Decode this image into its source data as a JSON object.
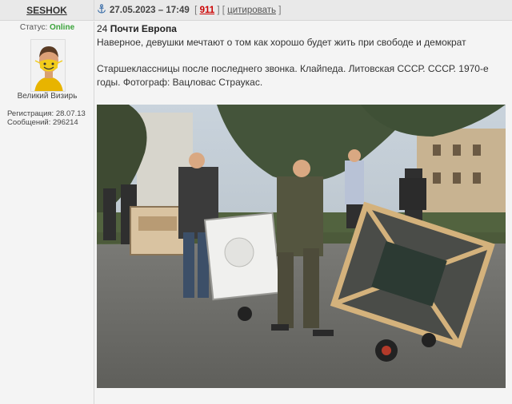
{
  "author": {
    "name": "SESHOK",
    "status_label": "Статус:",
    "status_value": "Online",
    "rank": "Великий Визирь",
    "registration_label": "Регистрация:",
    "registration_value": "28.07.13",
    "messages_label": "Сообщений:",
    "messages_value": "296214"
  },
  "meta": {
    "date": "27.05.2023 – 17:49",
    "post_number": "911",
    "quote_label": "цитировать"
  },
  "post": {
    "index": "24",
    "title": "Почти Европа",
    "text1": "Наверное, девушки мечтают о том как хорошо будет жить при свободе и демократ",
    "text2": "Старшеклассницы после последнего звонка. Клайпеда. Литовская ССCР. СССР. 1970-е годы. Фотограф: Вацловас Страукас."
  },
  "colors": {
    "status_online": "#3aa33a",
    "post_number": "#cc0000"
  }
}
